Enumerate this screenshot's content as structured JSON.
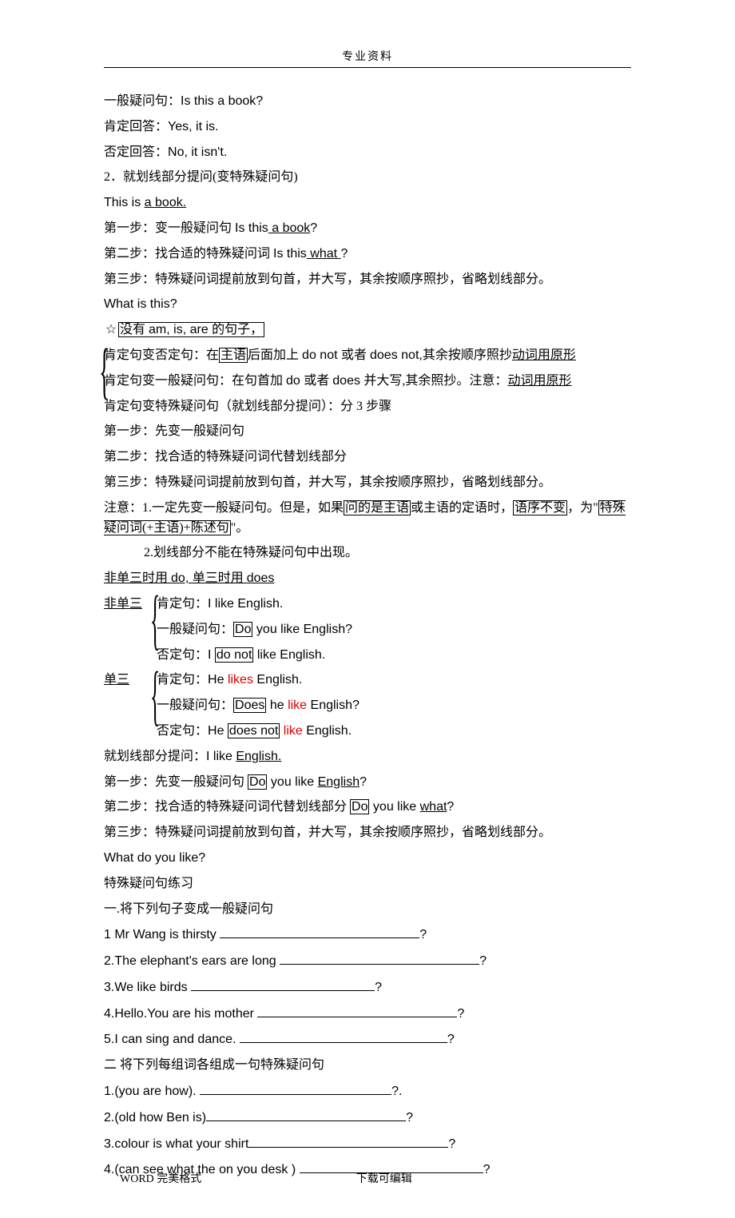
{
  "header": "专业资料",
  "lines": {
    "l1a": "一般疑问句：",
    "l1b": "Is this a book?",
    "l2a": "肯定回答：",
    "l2b": "Yes, it is.",
    "l3a": "否定回答：",
    "l3b": "No, it isn't.",
    "l4": "2．就划线部分提问(变特殊疑问句)",
    "l5a": "This is ",
    "l5b": "a book.",
    "l6a": "第一步：变一般疑问句  ",
    "l6b": "Is this",
    "l6c": " a book",
    "l6d": "?",
    "l7a": "第二步：找合适的特殊疑问词  ",
    "l7b": "Is this",
    "l7c": " what ",
    "l7d": "?",
    "l8": "第三步：特殊疑问词提前放到句首，并大写，其余按顺序照抄，省略划线部分。",
    "l9": "What is this?",
    "l10a": "没有 ",
    "l10b": "am, is, are ",
    "l10c": "的句子，",
    "l11a": "肯定句变否定句：在",
    "l11b": "主语",
    "l11c": "后面加上 ",
    "l11d": "do not ",
    "l11e": "或者 ",
    "l11f": "does not,",
    "l11g": "其余按顺序照抄",
    "l11h": "动词用原形",
    "l12a": "肯定句变一般疑问句：在句首加 ",
    "l12b": "do ",
    "l12c": "或者 ",
    "l12d": "does ",
    "l12e": "并大写,其余照抄。注意：",
    "l12f": "动词用原形",
    "l13": "肯定句变特殊疑问句（就划线部分提问）：分 3 步骤",
    "l14": "第一步：先变一般疑问句",
    "l15": "第二步：找合适的特殊疑问词代替划线部分",
    "l16": "第三步：特殊疑问词提前放到句首，并大写，其余按顺序照抄，省略划线部分。",
    "l17a": "注意：1.一定先变一般疑问句。但是，如果",
    "l17b": "问的是主语",
    "l17c": "或主语的定语时，",
    "l17d": "语序不变",
    "l17e": "，为\"",
    "l17f": "特殊疑问词(+主语)+陈述句",
    "l17g": "\"。",
    "l18": "2.划线部分不能在特殊疑问句中出现。",
    "l19a": "非单三时用 ",
    "l19b": "do, ",
    "l19c": " 单三时用 ",
    "l19d": "does",
    "l20": "非单三",
    "l20a": "肯定句：",
    "l20b": "I like English.",
    "l21a": "一般疑问句：",
    "l21b": "Do",
    "l21c": " you like English?",
    "l22a": "否定句：",
    "l22b": "I ",
    "l22c": "do not",
    "l22d": " like English.",
    "l23": "单三",
    "l23a": "肯定句：",
    "l23b": "He ",
    "l23c": "likes",
    "l23d": " English.",
    "l24a": "一般疑问句：",
    "l24b": "Does",
    "l24c": " he ",
    "l24d": "like",
    "l24e": " English?",
    "l25a": "否定句：",
    "l25b": "He ",
    "l25c": "does not",
    "l25d": " ",
    "l25e": "like",
    "l25f": " English.",
    "l26a": "就划线部分提问：",
    "l26b": "I like ",
    "l26c": "English.",
    "l27a": "第一步：先变一般疑问句 ",
    "l27b": "Do",
    "l27c": " you like ",
    "l27d": "English",
    "l27e": "?",
    "l28a": "第二步：找合适的特殊疑问词代替划线部分 ",
    "l28b": "Do",
    "l28c": " you like ",
    "l28d": "what",
    "l28e": "?",
    "l29": "第三步：特殊疑问词提前放到句首，并大写，其余按顺序照抄，省略划线部分。",
    "l30": "What do you like?",
    "l31": "特殊疑问句练习",
    "l32": "一.将下列句子变成一般疑问句",
    "q1": "1 Mr Wang is thirsty ",
    "q2": "2.The elephant's ears are long ",
    "q3": "3.We like birds ",
    "q4": "4.Hello.You are his mother ",
    "q5": "5.I can sing and dance. ",
    "l33": "二 将下列每组词各组成一句特殊疑问句",
    "p1": "1.(you are how). ",
    "p2": "2.(old how Ben is)",
    "p3": "3.colour is what your shirt",
    "p4": "4.(can see what the on you desk ) ",
    "qm": "?",
    "qmDot": "?."
  },
  "footer": {
    "left": "WORD 完美格式",
    "right": "下载可编辑"
  }
}
